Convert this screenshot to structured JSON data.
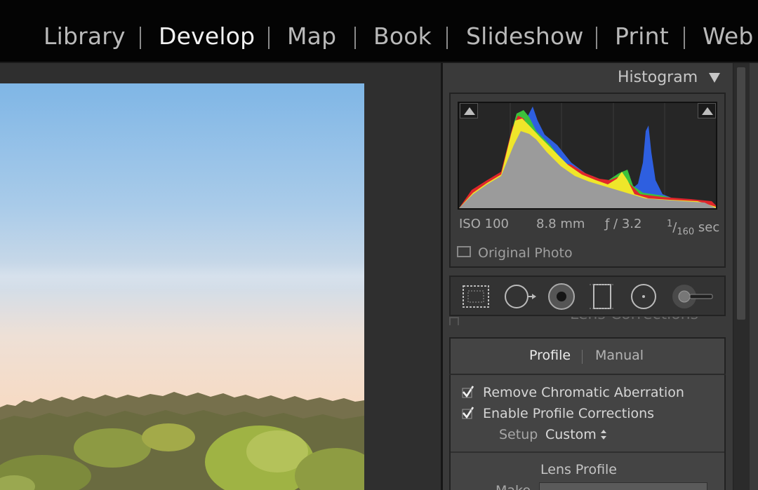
{
  "modules": {
    "library": "Library",
    "develop": "Develop",
    "map": "Map",
    "book": "Book",
    "slideshow": "Slideshow",
    "print": "Print",
    "web": "Web",
    "active": "Develop"
  },
  "histogram": {
    "title": "Histogram",
    "exif": {
      "iso": "ISO 100",
      "focal_length": "8.8 mm",
      "aperture": "ƒ / 3.2",
      "shutter_num": "1",
      "shutter_den": "160",
      "shutter_unit": "sec"
    },
    "original_photo_label": "Original Photo",
    "original_photo_checked": false
  },
  "tools": {
    "items": [
      "crop-overlay-icon",
      "spot-removal-icon",
      "red-eye-icon",
      "graduated-filter-icon",
      "radial-filter-icon",
      "adjustment-brush-icon"
    ]
  },
  "lens_corrections": {
    "title": "Lens Corrections",
    "tabs": [
      "Profile",
      "Manual"
    ],
    "active_tab": "Profile",
    "remove_ca_label": "Remove Chromatic Aberration",
    "remove_ca_checked": true,
    "enable_profile_label": "Enable Profile Corrections",
    "enable_profile_checked": true,
    "setup_label": "Setup",
    "setup_value": "Custom",
    "lens_profile_title": "Lens Profile",
    "make_label": "Make"
  },
  "colors": {
    "accent_text": "#f2f2f2",
    "panel_bg": "#3a3a3a",
    "histogram_red": "#e0262b",
    "histogram_green": "#3cc23c",
    "histogram_blue": "#2e5fe0",
    "histogram_yellow": "#efe62a"
  }
}
